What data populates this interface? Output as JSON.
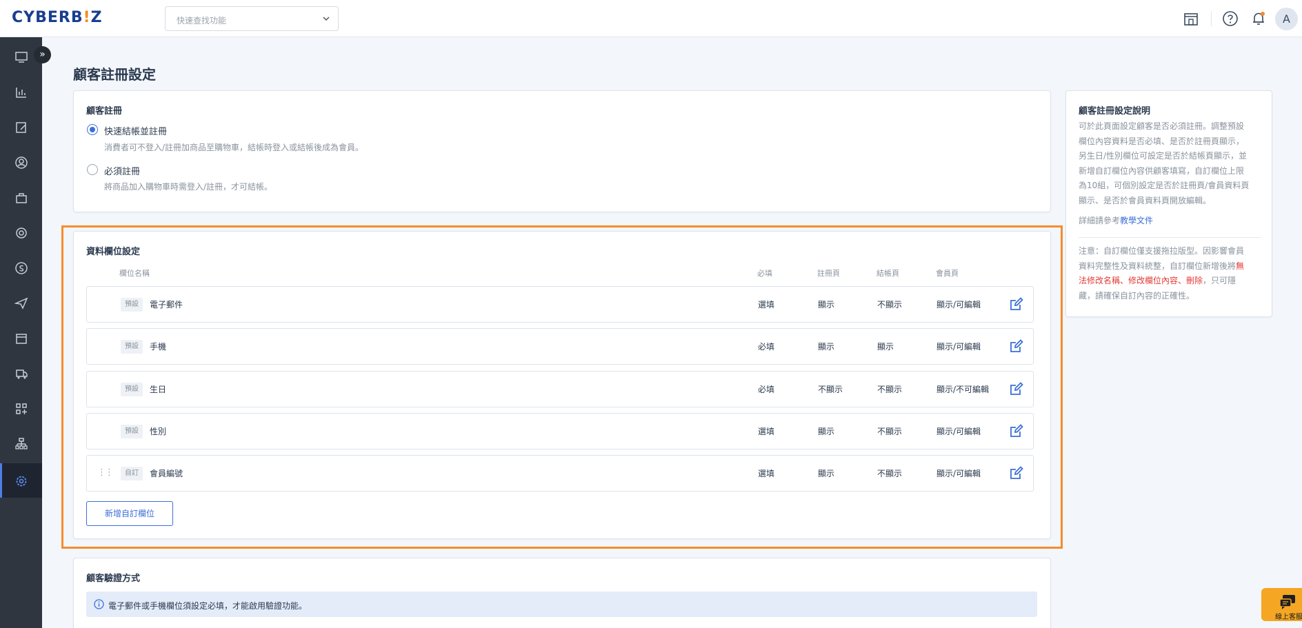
{
  "header": {
    "logo_main": "CYBERB",
    "logo_accent": "!",
    "logo_tail": "Z",
    "quick_search_placeholder": "快速查找功能",
    "avatar_initial": "A"
  },
  "page": {
    "title": "顧客註冊設定"
  },
  "registration": {
    "title": "顧客註冊",
    "options": [
      {
        "label": "快速結帳並註冊",
        "description": "消費者可不登入/註冊加商品至購物車，結帳時登入或結帳後成為會員。",
        "checked": true
      },
      {
        "label": "必須註冊",
        "description": "將商品加入購物車時需登入/註冊，才可結帳。",
        "checked": false
      }
    ]
  },
  "fields": {
    "title": "資料欄位設定",
    "columns": {
      "name": "欄位名稱",
      "required": "必填",
      "register": "註冊頁",
      "checkout": "結帳頁",
      "member": "會員頁"
    },
    "rows": [
      {
        "tag": "預設",
        "name": "電子郵件",
        "required": "選填",
        "register": "顯示",
        "checkout": "不顯示",
        "member": "顯示/可編輯",
        "draggable": false
      },
      {
        "tag": "預設",
        "name": "手機",
        "required": "必填",
        "register": "顯示",
        "checkout": "顯示",
        "member": "顯示/可編輯",
        "draggable": false
      },
      {
        "tag": "預設",
        "name": "生日",
        "required": "必填",
        "register": "不顯示",
        "checkout": "不顯示",
        "member": "顯示/不可編輯",
        "draggable": false
      },
      {
        "tag": "預設",
        "name": "性別",
        "required": "選填",
        "register": "顯示",
        "checkout": "不顯示",
        "member": "顯示/可編輯",
        "draggable": false
      },
      {
        "tag": "自訂",
        "name": "會員編號",
        "required": "選填",
        "register": "顯示",
        "checkout": "不顯示",
        "member": "顯示/可編輯",
        "draggable": true
      }
    ],
    "add_button": "新增自訂欄位"
  },
  "verification": {
    "title": "顧客驗證方式",
    "info": "電子郵件或手機欄位須設定必填，才能啟用驗證功能。"
  },
  "help": {
    "title": "顧客註冊設定說明",
    "lines": [
      "可於此頁面設定顧客是否必須註冊。調整預設",
      "欄位內容資料是否必填、是否於註冊頁顯示，",
      "另生日/性別欄位可設定是否於結帳頁顯示，並",
      "新增自訂欄位內容供顧客填寫，自訂欄位上限",
      "為10組，可個別設定是否於註冊頁/會員資料頁",
      "顯示、是否於會員資料頁開放編輯。"
    ],
    "ref_prefix": "詳細請參考",
    "ref_link": "教學文件",
    "note_1": "注意：自訂欄位僅支援拖拉版型。因影響會員",
    "note_2a": "資料完整性及資料統整，自訂欄位新增後將",
    "note_2b": "無",
    "note_3a": "法修改名稱、修改欄位內容、刪除",
    "note_3b": "，只可隱",
    "note_4": "藏，請確保自訂內容的正確性。"
  },
  "chat": {
    "label": "線上客服"
  },
  "colors": {
    "accent": "#3b6fd8",
    "highlight": "#f58c2e",
    "sidebar": "#2f3640",
    "warning": "#e53935",
    "chat": "#f5a623"
  }
}
